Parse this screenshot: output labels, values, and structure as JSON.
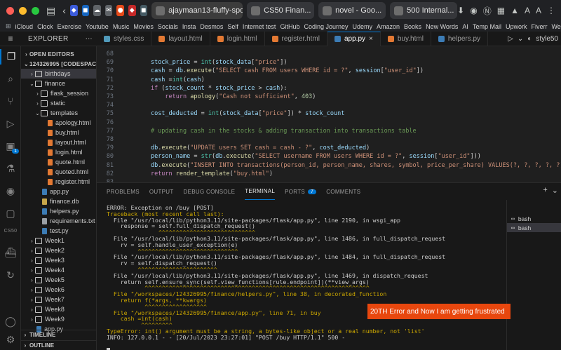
{
  "browser": {
    "tabs": [
      {
        "label": "ajaymaan13-fluffy-spoon",
        "active": true
      },
      {
        "label": "CS50 Finan..."
      },
      {
        "label": "novel - Goo..."
      },
      {
        "label": "500 Internal..."
      }
    ],
    "right_icons": [
      "A",
      "A"
    ],
    "bookmarks": [
      "iCloud",
      "Clock",
      "Exercise",
      "Youtube",
      "Music",
      "Movies",
      "Socials",
      "Insta",
      "Desmos",
      "Self",
      "Internet test",
      "GitHub",
      "Coding Journey",
      "Udemy",
      "Amazon",
      "Books",
      "New Words",
      "AI",
      "Temp Mail",
      "Upwork",
      "Fiverr",
      "Websites"
    ]
  },
  "vscode": {
    "explorer_label": "EXPLORER",
    "editor_tabs": [
      {
        "label": "styles.css",
        "kind": "css"
      },
      {
        "label": "layout.html",
        "kind": "html"
      },
      {
        "label": "login.html",
        "kind": "html"
      },
      {
        "label": "register.html",
        "kind": "html"
      },
      {
        "label": "app.py",
        "kind": "py",
        "active": true
      },
      {
        "label": "buy.html",
        "kind": "html"
      },
      {
        "label": "helpers.py",
        "kind": "py"
      }
    ],
    "editor_actions_label": "style50",
    "activity_badge": "1",
    "activity_label": "CS50",
    "sidebar": [
      {
        "label": "OPEN EDITORS",
        "kind": "section",
        "chev": "›"
      },
      {
        "label": "124326995 [CODESPAC...",
        "kind": "section",
        "chev": "⌄"
      },
      {
        "label": "birthdays",
        "kind": "folder",
        "chev": "›",
        "depth": 1,
        "selected": true
      },
      {
        "label": "finance",
        "kind": "folder",
        "chev": "⌄",
        "depth": 1
      },
      {
        "label": "flask_session",
        "kind": "folder",
        "chev": "›",
        "depth": 2
      },
      {
        "label": "static",
        "kind": "folder",
        "chev": "›",
        "depth": 2
      },
      {
        "label": "templates",
        "kind": "folder",
        "chev": "⌄",
        "depth": 2
      },
      {
        "label": "apology.html",
        "kind": "html",
        "depth": 3
      },
      {
        "label": "buy.html",
        "kind": "html",
        "depth": 3
      },
      {
        "label": "layout.html",
        "kind": "html",
        "depth": 3
      },
      {
        "label": "login.html",
        "kind": "html",
        "depth": 3
      },
      {
        "label": "quote.html",
        "kind": "html",
        "depth": 3
      },
      {
        "label": "quoted.html",
        "kind": "html",
        "depth": 3
      },
      {
        "label": "register.html",
        "kind": "html",
        "depth": 3
      },
      {
        "label": "app.py",
        "kind": "py",
        "depth": 2
      },
      {
        "label": "finance.db",
        "kind": "db",
        "depth": 2
      },
      {
        "label": "helpers.py",
        "kind": "py",
        "depth": 2
      },
      {
        "label": "requirements.txt",
        "kind": "txt",
        "depth": 2
      },
      {
        "label": "test.py",
        "kind": "py",
        "depth": 2
      },
      {
        "label": "Week1",
        "kind": "folder",
        "chev": "›",
        "depth": 1
      },
      {
        "label": "Week2",
        "kind": "folder",
        "chev": "›",
        "depth": 1
      },
      {
        "label": "Week3",
        "kind": "folder",
        "chev": "›",
        "depth": 1
      },
      {
        "label": "Week4",
        "kind": "folder",
        "chev": "›",
        "depth": 1
      },
      {
        "label": "Week5",
        "kind": "folder",
        "chev": "›",
        "depth": 1
      },
      {
        "label": "Week6",
        "kind": "folder",
        "chev": "›",
        "depth": 1
      },
      {
        "label": "Week7",
        "kind": "folder",
        "chev": "›",
        "depth": 1
      },
      {
        "label": "Week8",
        "kind": "folder",
        "chev": "›",
        "depth": 1
      },
      {
        "label": "Week9",
        "kind": "folder",
        "chev": "›",
        "depth": 1
      },
      {
        "label": "app.py",
        "kind": "py",
        "depth": 1
      }
    ],
    "sidebar_bottom": [
      "TIMELINE",
      "OUTLINE"
    ],
    "code_lines": [
      {
        "n": "68",
        "text": ""
      },
      {
        "n": "69",
        "text": "        stock_price = int(stock_data[\"price\"])"
      },
      {
        "n": "70",
        "text": "        cash = db.execute(\"SELECT cash FROM users WHERE id = ?\", session[\"user_id\"])"
      },
      {
        "n": "71",
        "text": "        cash =int(cash)"
      },
      {
        "n": "72",
        "text": "        if (stock_count * stock_price > cash):"
      },
      {
        "n": "73",
        "text": "            return apology(\"Cash not sufficient\", 403)"
      },
      {
        "n": "74",
        "text": ""
      },
      {
        "n": "75",
        "text": "        cost_deducted = int(stock_data[\"price\"]) * stock_count"
      },
      {
        "n": "76",
        "text": ""
      },
      {
        "n": "77",
        "text": "        # updating cash in the stocks & adding transaction into transactions table"
      },
      {
        "n": "78",
        "text": ""
      },
      {
        "n": "79",
        "text": "        db.execute(\"UPDATE users SET cash = cash - ?\", cost_deducted)"
      },
      {
        "n": "80",
        "text": "        person_name = str(db.execute(\"SELECT username FROM users WHERE id = ?\", session[\"user_id\"]))"
      },
      {
        "n": "81",
        "text": "        db.execute(\"INSERT INTO transactions(person_id, person_name, shares, symbol, price_per_share) VALUES(?, ?, ?, ?, ?)\", session[\"user_id\"], person_name, stock_count, stock_symbol, stock_price)"
      },
      {
        "n": "82",
        "text": "        return render_template(\"buy.html\")"
      },
      {
        "n": "83",
        "text": ""
      }
    ],
    "panel_tabs": [
      "PROBLEMS",
      "OUTPUT",
      "DEBUG CONSOLE",
      "TERMINAL",
      "PORTS",
      "COMMENTS"
    ],
    "panel_active_tab": "TERMINAL",
    "ports_badge": "7",
    "terminal_lines": [
      {
        "t": "ERROR: Exception on /buy [POST]",
        "k": "plain"
      },
      {
        "t": "Traceback (most recent call last):",
        "k": "warn"
      },
      {
        "t": "  File \"/usr/local/lib/python3.11/site-packages/flask/app.py\", line 2190, in wsgi_app",
        "k": "plain"
      },
      {
        "t": "    response = self.full_dispatch_request()",
        "k": "plain"
      },
      {
        "t": "               ^^^^^^^^^^^^^^^^^^^^^^^^^^^^",
        "k": "caret"
      },
      {
        "t": "  File \"/usr/local/lib/python3.11/site-packages/flask/app.py\", line 1486, in full_dispatch_request",
        "k": "plain"
      },
      {
        "t": "    rv = self.handle_user_exception(e)",
        "k": "plain"
      },
      {
        "t": "         ^^^^^^^^^^^^^^^^^^^^^^^^^^^^^",
        "k": "caret"
      },
      {
        "t": "  File \"/usr/local/lib/python3.11/site-packages/flask/app.py\", line 1484, in full_dispatch_request",
        "k": "plain"
      },
      {
        "t": "    rv = self.dispatch_request()",
        "k": "plain"
      },
      {
        "t": "         ^^^^^^^^^^^^^^^^^^^^^^^",
        "k": "caret"
      },
      {
        "t": "  File \"/usr/local/lib/python3.11/site-packages/flask/app.py\", line 1469, in dispatch_request",
        "k": "plain"
      },
      {
        "t": "    return self.ensure_sync(self.view_functions[rule.endpoint])(**view_args)",
        "k": "plain"
      },
      {
        "t": "           ^^^^^^^^^^^^^^^^^^^^^^^^^^^^^^^^^^^^^^^^^^^^^^^^^^^^^^^^^^^^^^^^^",
        "k": "caret"
      },
      {
        "t": "  File \"/workspaces/124326995/finance/helpers.py\", line 38, in decorated_function",
        "k": "warn"
      },
      {
        "t": "    return f(*args, **kwargs)",
        "k": "warn"
      },
      {
        "t": "           ^^^^^^^^^^^^^^^^^^",
        "k": "caret"
      },
      {
        "t": "  File \"/workspaces/124326995/finance/app.py\", line 71, in buy",
        "k": "warn"
      },
      {
        "t": "    cash =int(cash)",
        "k": "warn"
      },
      {
        "t": "          ^^^^^^^^^",
        "k": "caret"
      },
      {
        "t": "TypeError: int() argument must be a string, a bytes-like object or a real number, not 'list'",
        "k": "warn"
      },
      {
        "t": "INFO: 127.0.0.1 - - [20/Jul/2023 23:27:01] \"POST /buy HTTP/1.1\" 500 -",
        "k": "plain"
      }
    ],
    "terminal_shells": [
      {
        "label": "bash"
      },
      {
        "label": "bash",
        "active": true
      }
    ],
    "annotation": "20TH Error  and Now I am getting frustrated"
  },
  "colors": {
    "accent": "#0078d4",
    "annotation_bg": "#e8470e",
    "editor_bg": "#1f1f1f",
    "panel_bg": "#181818"
  }
}
